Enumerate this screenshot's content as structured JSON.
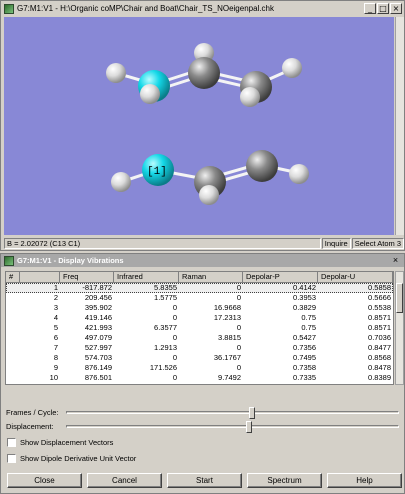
{
  "viewer": {
    "title": "G7:M1:V1 - H:\\Organic coMP\\Chair and Boat\\Chair_TS_NOeigenpal.chk",
    "controls": {
      "minimize": "_",
      "maximize": "□",
      "close": "×"
    },
    "atom_label": "[1]",
    "status": "B = 2.02072 (C13 C1)",
    "status_right": [
      "Inquire",
      "Select Atom 3"
    ],
    "colors": {
      "background": "#8888d6",
      "nitrogen": "#14d8e8",
      "carbon": "#808080",
      "hydrogen": "#e0e0e0"
    }
  },
  "vibrations": {
    "title": "G7:M1:V1 - Display Vibrations",
    "close": "×",
    "columns": [
      "#",
      "Freq",
      "Infrared",
      "Raman",
      "Depolar-P",
      "Depolar-U"
    ],
    "rows": [
      [
        "1",
        "-817.872",
        "5.8355",
        "0",
        "0.4142",
        "0.5858"
      ],
      [
        "2",
        "209.456",
        "1.5775",
        "0",
        "0.3953",
        "0.5666"
      ],
      [
        "3",
        "395.902",
        "0",
        "16.9668",
        "0.3829",
        "0.5538"
      ],
      [
        "4",
        "419.146",
        "0",
        "17.2313",
        "0.75",
        "0.8571"
      ],
      [
        "5",
        "421.993",
        "6.3577",
        "0",
        "0.75",
        "0.8571"
      ],
      [
        "6",
        "497.079",
        "0",
        "3.8815",
        "0.5427",
        "0.7036"
      ],
      [
        "7",
        "527.997",
        "1.2913",
        "0",
        "0.7356",
        "0.8477"
      ],
      [
        "8",
        "574.703",
        "0",
        "36.1767",
        "0.7495",
        "0.8568"
      ],
      [
        "9",
        "876.149",
        "171.526",
        "0",
        "0.7358",
        "0.8478"
      ],
      [
        "10",
        "876.501",
        "0",
        "9.7492",
        "0.7335",
        "0.8389"
      ]
    ],
    "selected_row": 0,
    "sliders": [
      {
        "label": "Frames / Cycle:",
        "value": 0.56
      },
      {
        "label": "Displacement:",
        "value": 0.55
      }
    ],
    "checkboxes": [
      {
        "label": "Show Displacement Vectors",
        "checked": false
      },
      {
        "label": "Show Dipole Derivative Unit Vector",
        "checked": false
      }
    ],
    "buttons": [
      "Close",
      "Cancel",
      "Start",
      "Spectrum",
      "Help"
    ]
  }
}
